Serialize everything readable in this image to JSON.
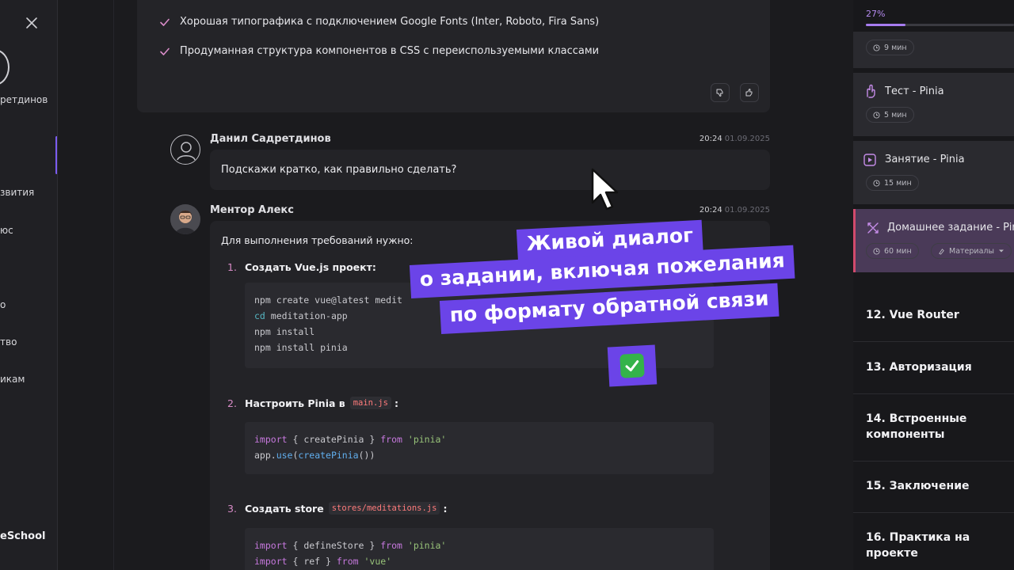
{
  "sidebar": {
    "user_name_partial": "ретдинов",
    "items": [
      {
        "label": "звития"
      },
      {
        "label": "юс"
      },
      {
        "label": "о"
      },
      {
        "label": "тво"
      },
      {
        "label": "икам"
      }
    ],
    "brand_partial": "eSchool"
  },
  "chat": {
    "prev_card": {
      "items": [
        "Хорошая типографика с подключением Google Fonts (Inter, Roboto, Fira Sans)",
        "Продуманная структура компонентов в CSS с переиспользуемыми классами"
      ]
    },
    "user_message": {
      "author": "Данил Садретдинов",
      "time": "20:24",
      "date": "01.09.2025",
      "text": "Подскажи кратко, как правильно сделать?"
    },
    "mentor_message": {
      "author": "Ментор Алекс",
      "time": "20:24",
      "date": "01.09.2025",
      "intro": "Для выполнения требований нужно:",
      "steps": [
        {
          "num": "1.",
          "title": "Создать Vue.js проект:",
          "code_inline": "",
          "code": [
            "npm create vue@latest medit",
            "cd meditation-app",
            "npm install",
            "npm install pinia"
          ]
        },
        {
          "num": "2.",
          "title": "Настроить Pinia в",
          "code_inline": "main.js",
          "title_suffix": ":",
          "code": [
            "import { createPinia } from 'pinia'",
            "app.use(createPinia())"
          ]
        },
        {
          "num": "3.",
          "title": "Создать store",
          "code_inline": "stores/meditations.js",
          "title_suffix": ":",
          "code": [
            "import { defineStore } from 'pinia'",
            "import { ref } from 'vue'"
          ]
        }
      ]
    }
  },
  "overlay": {
    "lines": [
      "Живой диалог",
      "о задании, включая пожелания",
      "по формату обратной связи"
    ],
    "emoji": "✅"
  },
  "right_panel": {
    "progress_label": "27%",
    "progress_value": 0.27,
    "lessons": [
      {
        "title": "",
        "duration": "9 мин",
        "icon": "clock-icon"
      },
      {
        "title": "Тест - Pinia",
        "duration": "5 мин",
        "icon": "test-icon"
      },
      {
        "title": "Занятие - Pinia",
        "duration": "15 мин",
        "icon": "lesson-icon"
      },
      {
        "title": "Домашнее задание - Pin",
        "duration": "60 мин",
        "materials": "Материалы",
        "icon": "homework-icon"
      }
    ],
    "modules": [
      "12. Vue Router",
      "13. Авторизация",
      "14. Встроенные компоненты",
      "15. Заключение",
      "16. Практика на проекте"
    ]
  },
  "colors": {
    "accent": "#7b5cf0",
    "overlay_bg": "#6b44e8",
    "active_lesson_bg": "#4a3a58",
    "active_lesson_border": "#d14a6c"
  }
}
